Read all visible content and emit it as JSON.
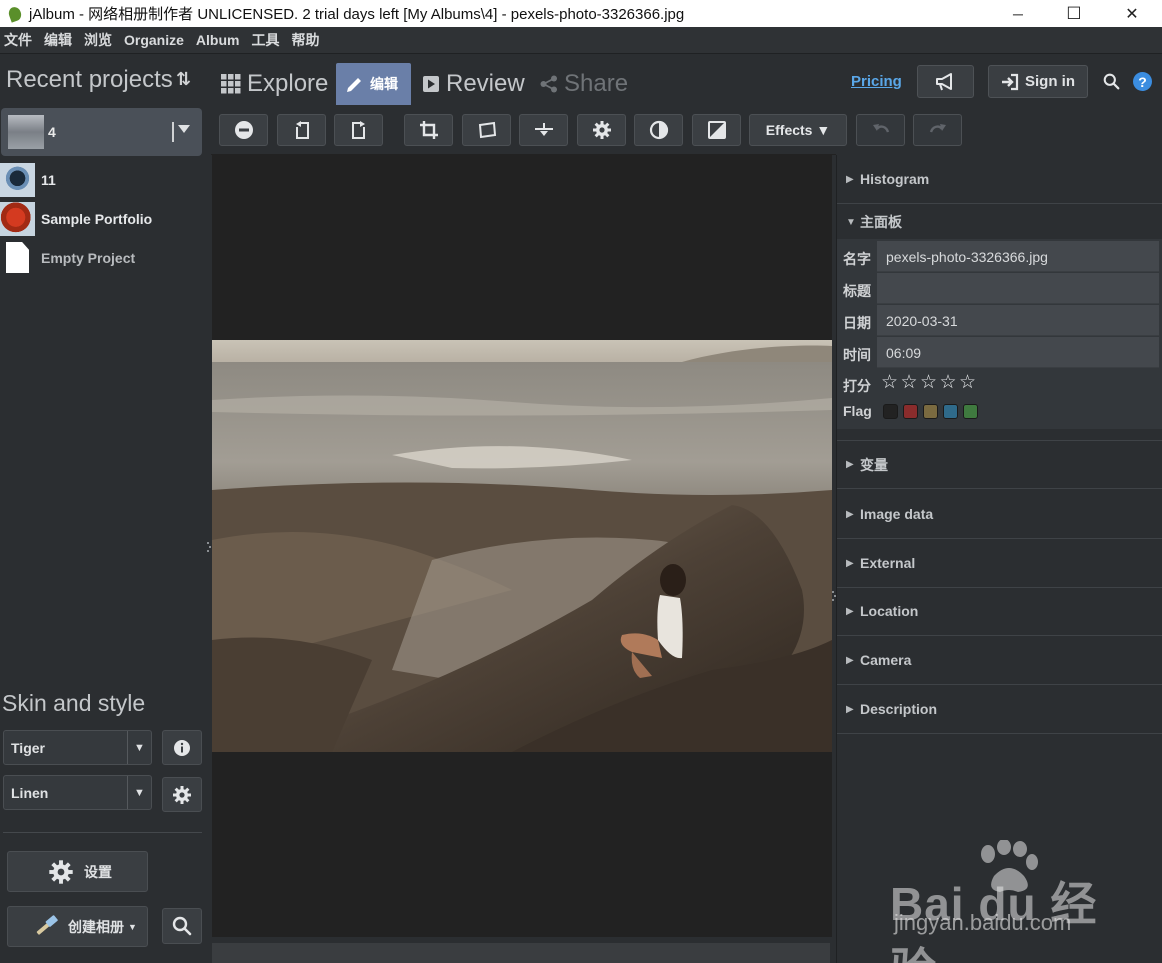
{
  "window": {
    "title": "jAlbum - 网络相册制作者 UNLICENSED. 2 trial days left [My Albums\\4] - pexels-photo-3326366.jpg",
    "minimize": "─",
    "maximize": "☐",
    "close": "✕"
  },
  "menu": [
    "文件",
    "编辑",
    "浏览",
    "Organize",
    "Album",
    "工具",
    "帮助"
  ],
  "left_panel": {
    "title": "Recent projects",
    "sort_icon": "⇅",
    "selected_project": "4",
    "projects": [
      "11",
      "Sample Portfolio",
      "Empty Project"
    ],
    "skin_title": "Skin and style",
    "skin": "Tiger",
    "style": "Linen",
    "settings_label": "设置",
    "make_album_label": "创建相册"
  },
  "tabs": {
    "explore": "Explore",
    "edit": "编辑",
    "review": "Review",
    "share": "Share"
  },
  "header": {
    "pricing": "Pricing",
    "sign_in": "Sign in",
    "help": "?"
  },
  "toolbar": {
    "effects": "Effects ▼"
  },
  "right_panel": {
    "histogram": "Histogram",
    "main_panel": "主面板",
    "fields": {
      "name_label": "名字",
      "name_value": "pexels-photo-3326366.jpg",
      "title_label": "标题",
      "title_value": "",
      "date_label": "日期",
      "date_value": "2020-03-31",
      "time_label": "时间",
      "time_value": "06:09",
      "rating_label": "打分",
      "rating_value": 0,
      "rating_max": 5,
      "flag_label": "Flag"
    },
    "flag_colors": [
      "#222222",
      "#8a2c2c",
      "#7a6a40",
      "#2f6a8a",
      "#3f7a3f"
    ],
    "sections": [
      "变量",
      "Image data",
      "External",
      "Location",
      "Camera",
      "Description"
    ]
  },
  "watermark": {
    "text": "Bai du 经验",
    "url": "jingyan.baidu.com"
  },
  "colors": {
    "accent": "#6a7fa8",
    "link": "#5aa7e8",
    "help": "#3b8de0"
  }
}
